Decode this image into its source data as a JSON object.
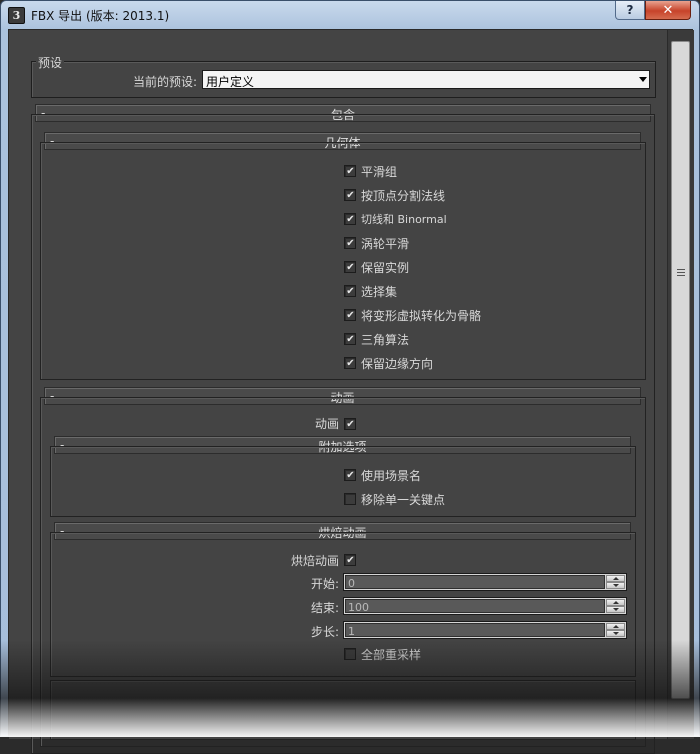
{
  "window": {
    "title": "FBX 导出 (版本: 2013.1)",
    "help_label": "?",
    "close_label": "✕",
    "icon_letter": "3"
  },
  "presets": {
    "group_label": "预设",
    "current_label": "当前的预设:",
    "current_value": "用户定义"
  },
  "include": {
    "title": "包含",
    "collapse": "-"
  },
  "geometry": {
    "title": "几何体",
    "collapse": "-",
    "options": [
      {
        "label": "平滑组",
        "checked": true
      },
      {
        "label": "按顶点分割法线",
        "checked": true
      },
      {
        "label": "切线和 Binormal",
        "checked": true
      },
      {
        "label": "涡轮平滑",
        "checked": true
      },
      {
        "label": "保留实例",
        "checked": true
      },
      {
        "label": "选择集",
        "checked": true
      },
      {
        "label": "将变形虚拟转化为骨骼",
        "checked": true
      },
      {
        "label": "三角算法",
        "checked": true
      },
      {
        "label": "保留边缘方向",
        "checked": true
      }
    ]
  },
  "animation": {
    "title": "动画",
    "collapse": "-",
    "toggle_label": "动画",
    "toggle_checked": true
  },
  "extra_options": {
    "title": "附加选项",
    "collapse": "-",
    "options": [
      {
        "label": "使用场景名",
        "checked": true
      },
      {
        "label": "移除单一关键点",
        "checked": false
      }
    ]
  },
  "bake": {
    "title": "烘焙动画",
    "collapse": "-",
    "toggle_label": "烘焙动画",
    "toggle_checked": true,
    "start_label": "开始:",
    "start_value": "0",
    "end_label": "结束:",
    "end_value": "100",
    "step_label": "步长:",
    "step_value": "1",
    "resample_label": "全部重采样",
    "resample_checked": false
  }
}
